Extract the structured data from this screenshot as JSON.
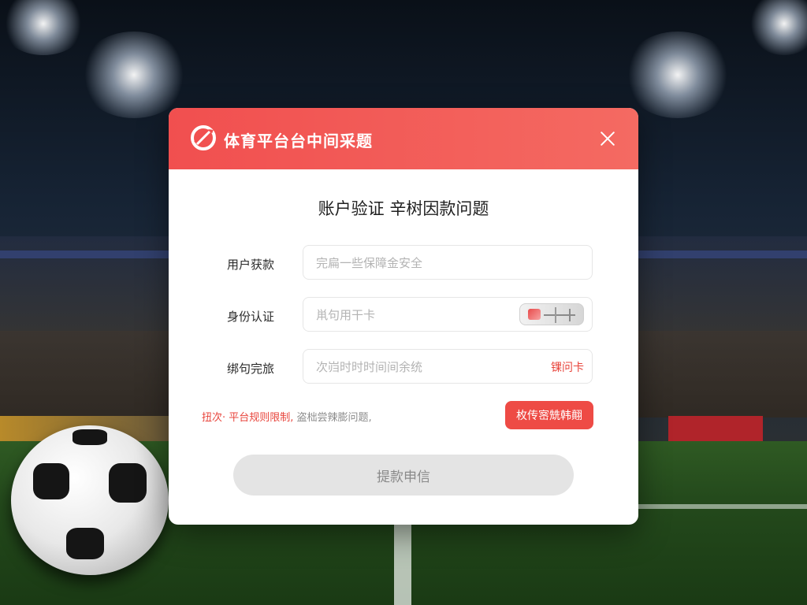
{
  "dialog": {
    "brand": "体育平台台中间采题",
    "title": "账户验证 辛树因款问题",
    "rows": [
      {
        "label": "用户获款",
        "placeholder": "完扁一些保障金安全"
      },
      {
        "label": "身份认证",
        "placeholder": "鼡句用干卡"
      },
      {
        "label": "绑句完旅",
        "placeholder": "次岿时时时间间余统",
        "link": "锞问卡"
      }
    ],
    "notice_highlight": "扭次· 平台规则限制,",
    "notice_rest": "盗柮尝辣膨问题,",
    "action_button": "枚传宻兟韩翸",
    "submit_button": "提款申信"
  },
  "colors": {
    "header_start": "#f14f4f",
    "header_end": "#f46a62",
    "accent": "#e8453c",
    "submit_bg": "#e4e4e4"
  },
  "icons": {
    "logo": "brand-logo-icon",
    "close": "close-icon",
    "card": "bank-card-icon"
  }
}
